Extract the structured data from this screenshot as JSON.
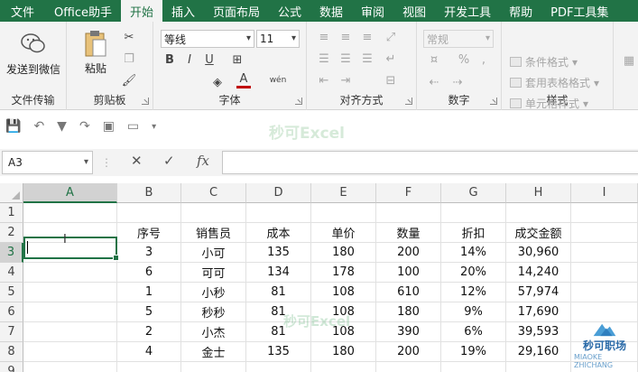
{
  "tabs": [
    "文件",
    "Office助手",
    "开始",
    "插入",
    "页面布局",
    "公式",
    "数据",
    "审阅",
    "视图",
    "开发工具",
    "帮助",
    "PDF工具集"
  ],
  "active_tab": "开始",
  "ribbon": {
    "send_wechat": "发送到微信",
    "file_transfer": "文件传输",
    "paste": "粘贴",
    "clipboard": "剪贴板",
    "font_name": "等线",
    "font_size": "11",
    "font": "字体",
    "bold": "B",
    "italic": "I",
    "underline": "U",
    "font_color_letter": "A",
    "phonetic": "wén",
    "align": "对齐方式",
    "number_format": "常规",
    "number": "数字",
    "percent": "%",
    "comma": ",",
    "cond_format": "条件格式",
    "table_format": "套用表格格式",
    "cell_style": "单元格样式",
    "styles": "样式"
  },
  "watermark": "秒可Excel",
  "name_box": "A3",
  "formula_fx": "fx",
  "columns": [
    "A",
    "B",
    "C",
    "D",
    "E",
    "F",
    "G",
    "H",
    "I"
  ],
  "rows": [
    "1",
    "2",
    "3",
    "4",
    "5",
    "6",
    "7",
    "8",
    "9"
  ],
  "table": {
    "headers": [
      "序号",
      "销售员",
      "成本",
      "单价",
      "数量",
      "折扣",
      "成交金额"
    ],
    "rows": [
      [
        "3",
        "小可",
        "135",
        "180",
        "200",
        "14%",
        "30,960"
      ],
      [
        "6",
        "可可",
        "134",
        "178",
        "100",
        "20%",
        "14,240"
      ],
      [
        "1",
        "小秒",
        "81",
        "108",
        "610",
        "12%",
        "57,974"
      ],
      [
        "5",
        "秒秒",
        "81",
        "108",
        "180",
        "9%",
        "17,690"
      ],
      [
        "2",
        "小杰",
        "81",
        "108",
        "390",
        "6%",
        "39,593"
      ],
      [
        "4",
        "金士",
        "135",
        "180",
        "200",
        "19%",
        "29,160"
      ]
    ]
  },
  "logo_text": "秒可职场",
  "logo_sub": "MIAOKE ZHICHANG"
}
